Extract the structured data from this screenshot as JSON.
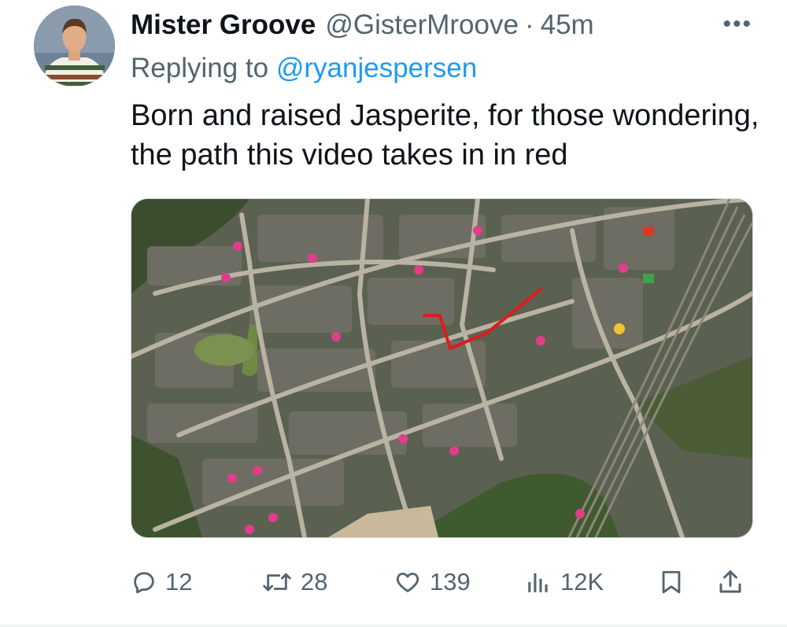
{
  "tweet": {
    "display_name": "Mister Groove",
    "handle": "@GisterMroove",
    "separator": "·",
    "time_ago": "45m",
    "more_label": "•••",
    "replying_prefix": "Replying to",
    "replying_to": "@ryanjespersen",
    "text": "Born and raised Jasperite, for those wondering, the path this video takes in in red"
  },
  "media": {
    "type": "satellite-map-image",
    "route_color": "#e01b1b"
  },
  "actions": {
    "reply_count": "12",
    "retweet_count": "28",
    "like_count": "139",
    "view_count": "12K"
  },
  "colors": {
    "primary_text": "#0f1419",
    "secondary_text": "#536471",
    "link": "#1d9bf0"
  },
  "icons": [
    "more-icon",
    "reply-icon",
    "retweet-icon",
    "like-icon",
    "views-icon",
    "bookmark-icon",
    "share-icon"
  ]
}
